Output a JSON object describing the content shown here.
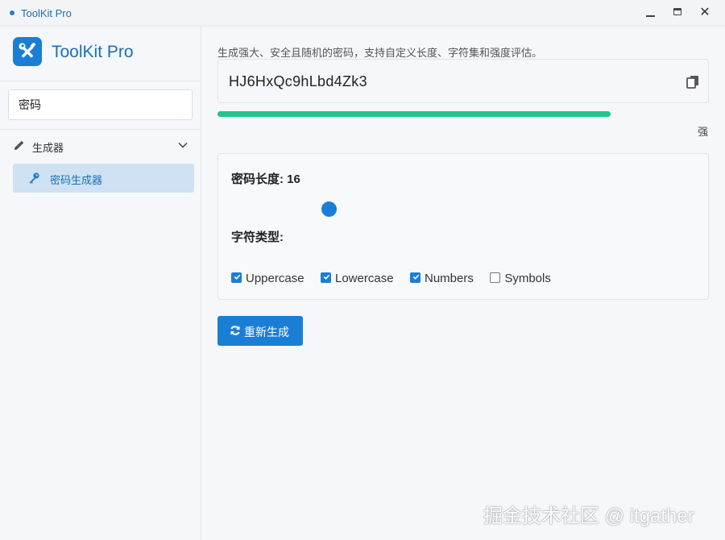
{
  "window": {
    "title": "ToolKit Pro",
    "controls": {
      "minimize": "minimize-icon",
      "maximize": "maximize-icon",
      "close": "✕"
    }
  },
  "sidebar": {
    "brand": {
      "name": "ToolKit Pro",
      "logo_icon": "tools-icon"
    },
    "search": {
      "value": "密码",
      "placeholder": ""
    },
    "groups": [
      {
        "label": "生成器",
        "icon": "pencil-icon",
        "expanded": true,
        "items": [
          {
            "label": "密码生成器",
            "icon": "key-icon",
            "selected": true
          }
        ]
      }
    ]
  },
  "main": {
    "description": "生成强大、安全且随机的密码，支持自定义长度、字符集和强度评估。",
    "password": "HJ6HxQc9hLbd4Zk3",
    "copy_icon": "copy-icon",
    "strength": {
      "label": "强",
      "fraction": 0.8,
      "color": "#22c58b"
    },
    "length_label": "密码长度: 16",
    "length_value": 16,
    "char_types_label": "字符类型:",
    "char_types": [
      {
        "label": "Uppercase",
        "checked": true
      },
      {
        "label": "Lowercase",
        "checked": true
      },
      {
        "label": "Numbers",
        "checked": true
      },
      {
        "label": "Symbols",
        "checked": false
      }
    ],
    "regenerate_label": "重新生成",
    "regenerate_icon": "refresh-icon"
  },
  "watermark": "掘金技术社区 @ itgather",
  "colors": {
    "accent": "#1a7fd4",
    "selected_bg": "#cfe1f3",
    "strength_bar": "#22c58b"
  }
}
